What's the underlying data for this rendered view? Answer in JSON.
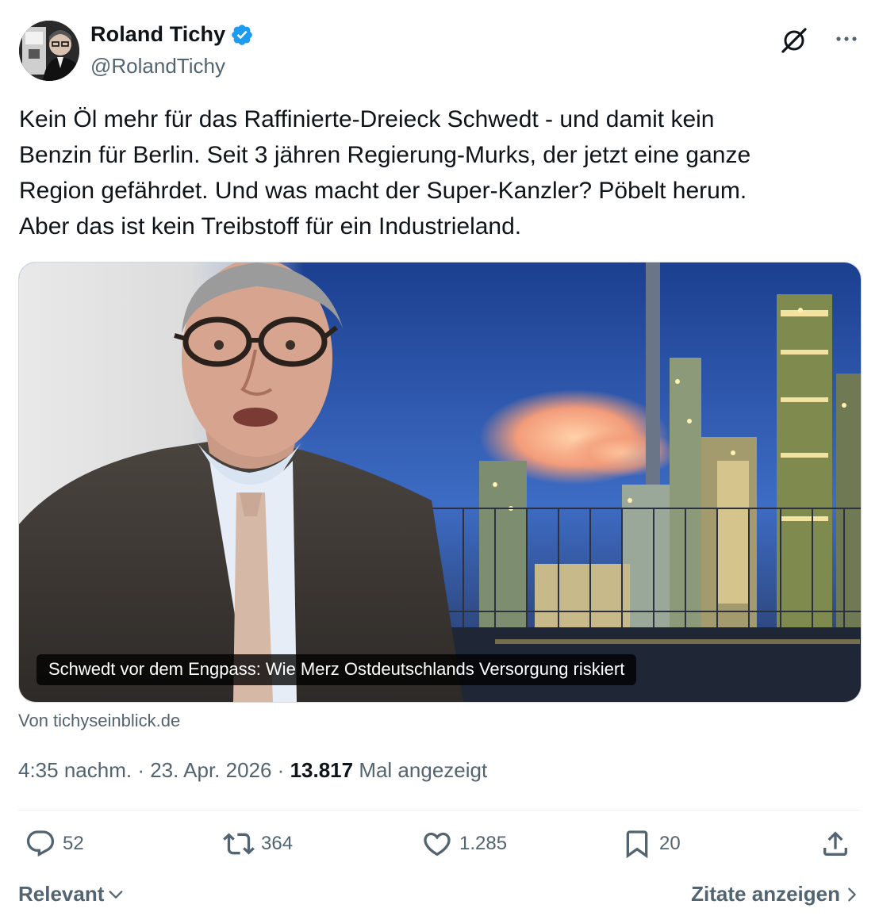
{
  "author": {
    "name": "Roland Tichy",
    "handle": "@RolandTichy",
    "verified": true,
    "verified_color": "#1d9bf0"
  },
  "tweet": {
    "text": "Kein Öl mehr für das Raffinierte-Dreieck Schwedt - und damit kein\nBenzin für Berlin. Seit 3 jähren Regierung-Murks, der jetzt eine ganze\nRegion gefährdet. Und was macht der Super-Kanzler? Pöbelt herum.\nAber das ist kein Treibstoff für ein Industrieland."
  },
  "link_card": {
    "caption": "Schwedt vor dem Engpass: Wie Merz Ostdeutschlands Versorgung riskiert",
    "source": "Von tichyseinblick.de"
  },
  "meta": {
    "time": "4:35 nachm.",
    "separator": " · ",
    "date": "23. Apr. 2026",
    "separator2": " · ",
    "views_count": "13.817",
    "views_label": " Mal angezeigt"
  },
  "actions": {
    "replies": "52",
    "reposts": "364",
    "likes": "1.285",
    "bookmarks": "20"
  },
  "footer": {
    "sort_label": "Relevant",
    "quotes_label": "Zitate anzeigen"
  },
  "icons": {
    "grok": "grok-icon",
    "more": "more-dots-icon",
    "reply": "reply-icon",
    "repost": "repost-icon",
    "like": "heart-icon",
    "bookmark": "bookmark-icon",
    "share": "share-icon"
  },
  "colors": {
    "text_primary": "#0f1419",
    "text_secondary": "#536471",
    "border": "#cfd9de"
  }
}
